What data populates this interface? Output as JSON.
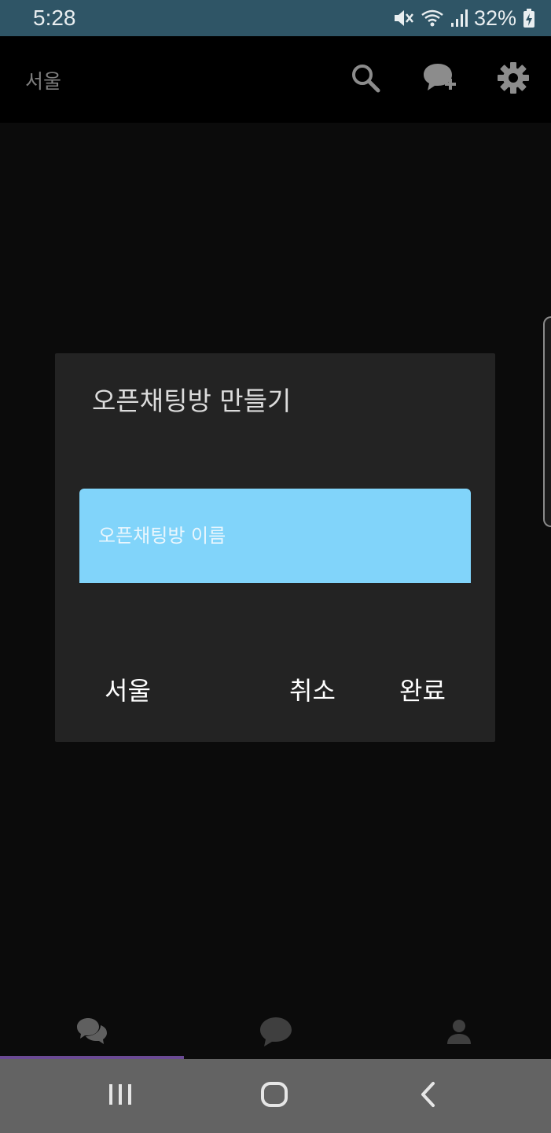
{
  "status_bar": {
    "time": "5:28",
    "battery_text": "32%",
    "icons": [
      "mute-icon",
      "wifi-icon",
      "signal-icon",
      "battery-charging-icon"
    ]
  },
  "app_bar": {
    "title": "서울",
    "actions": [
      "search-icon",
      "new-chat-icon",
      "settings-icon"
    ]
  },
  "dialog": {
    "title": "오픈채팅방 만들기",
    "input_placeholder": "오픈채팅방 이름",
    "input_value": "",
    "region_button_label": "서울",
    "cancel_label": "취소",
    "done_label": "완료"
  },
  "tab_bar": {
    "tabs": [
      "chats-icon",
      "chat-icon",
      "profile-icon"
    ],
    "selected_index": 0
  },
  "nav_bar": {
    "buttons": [
      "recents-icon",
      "home-icon",
      "back-icon"
    ]
  },
  "colors": {
    "status_bar": "#2f5566",
    "app_bar": "#000000",
    "background": "#0b0b0b",
    "dialog": "#232323",
    "input_fill": "#81d4fa",
    "tab_indicator": "#6a4a93",
    "nav_bar": "#636363"
  }
}
